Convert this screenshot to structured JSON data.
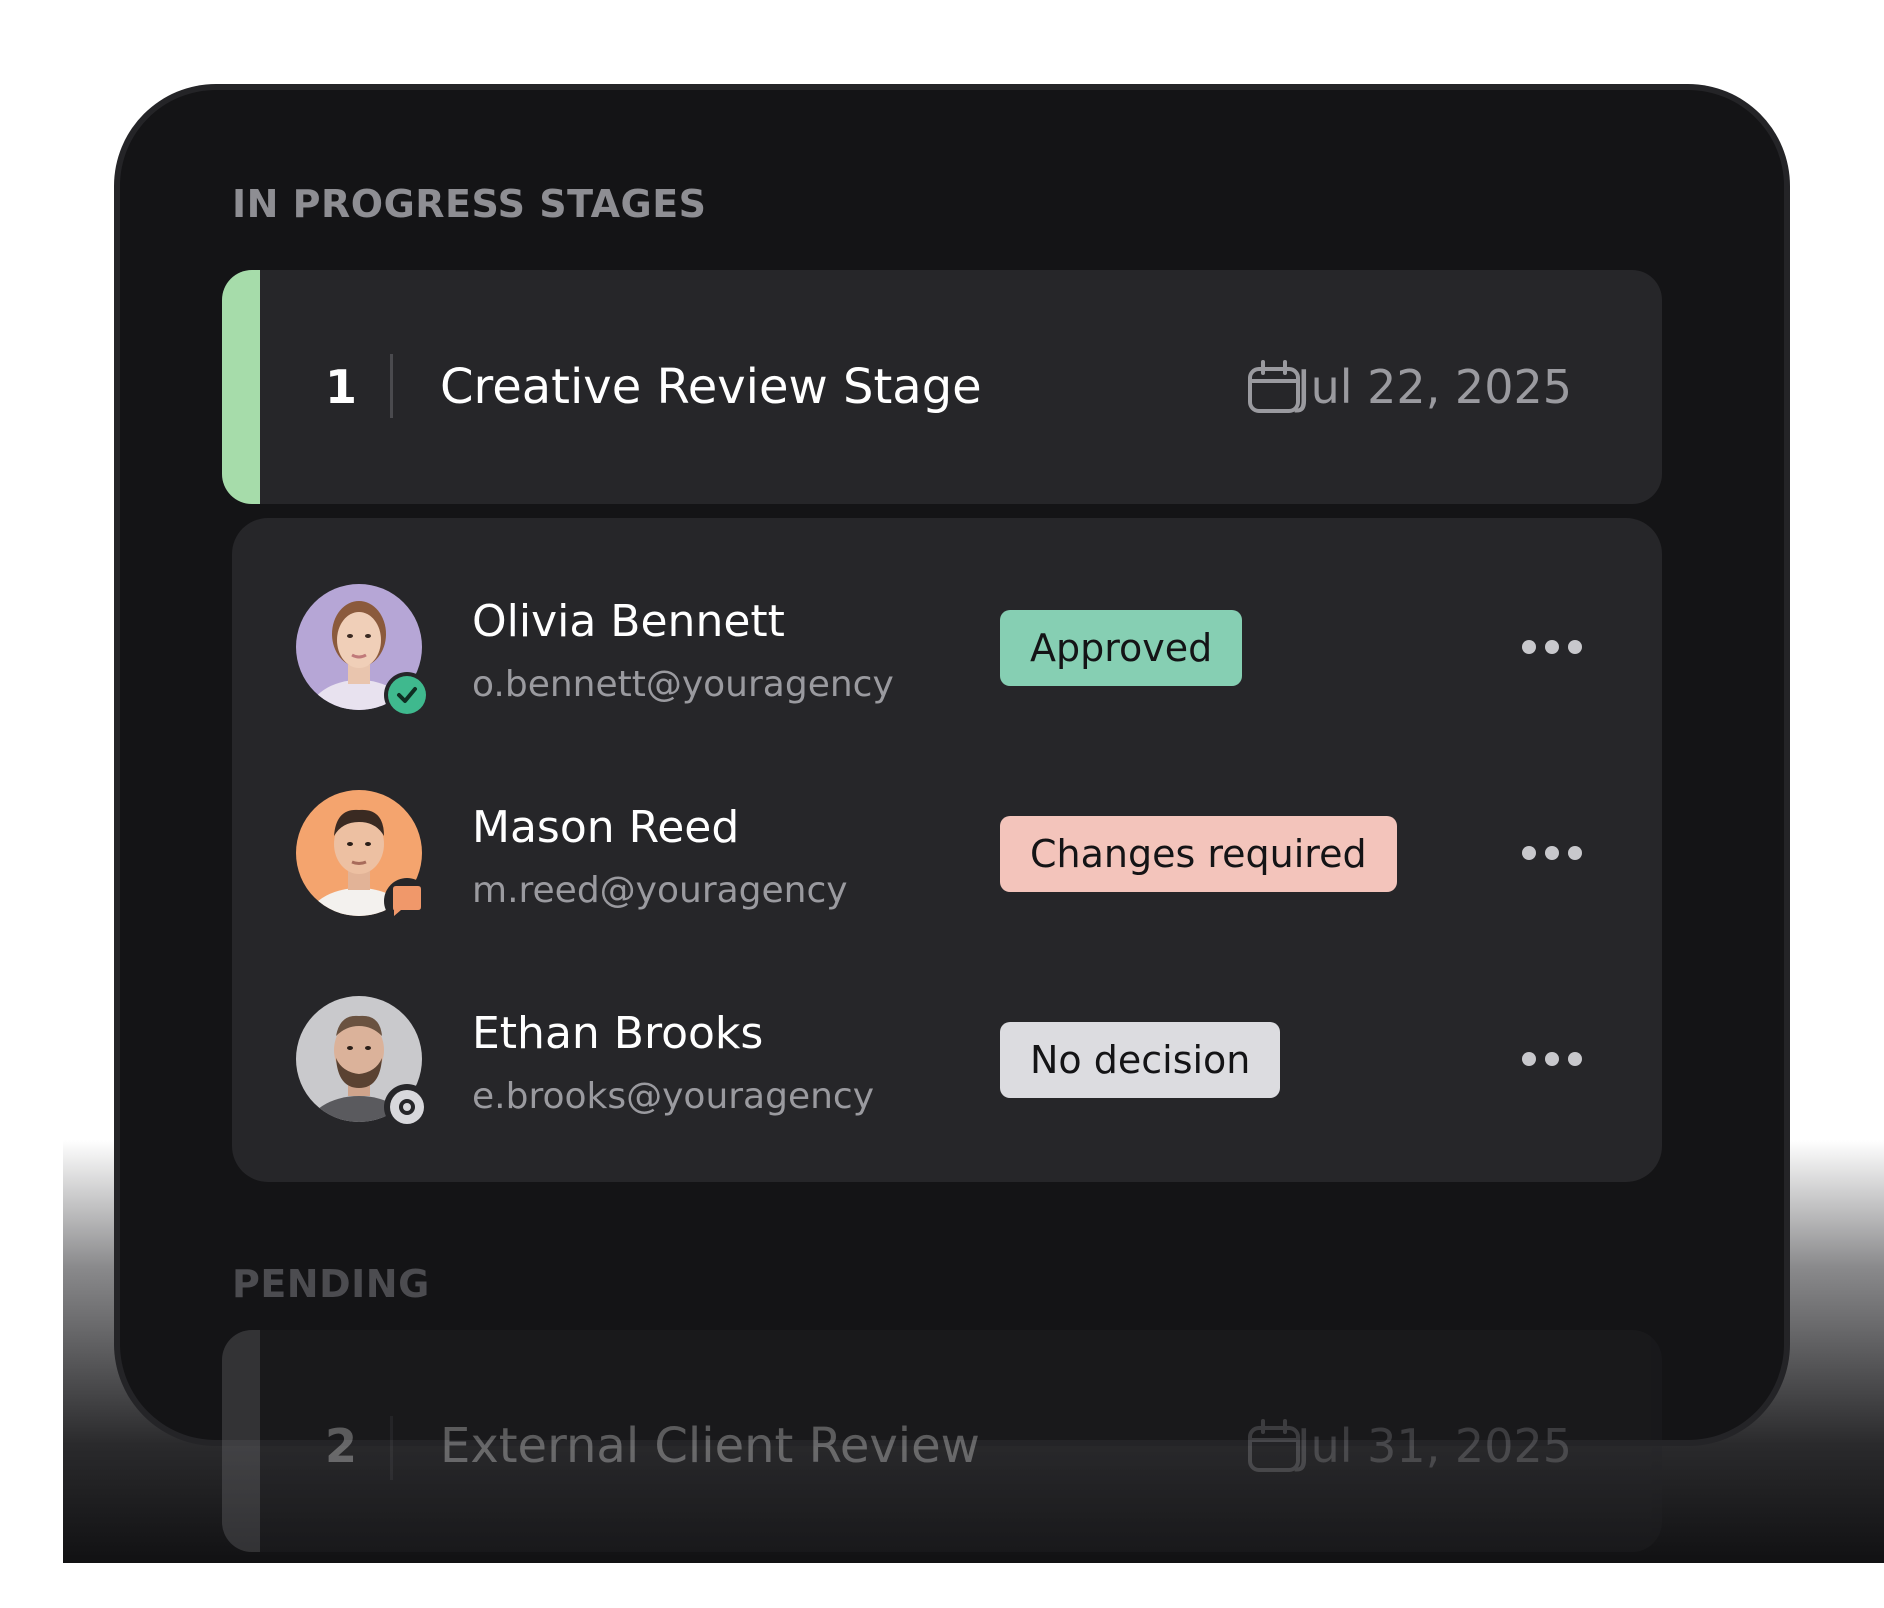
{
  "in_progress": {
    "section_label": "IN PROGRESS STAGES",
    "stage": {
      "number": "1",
      "title": "Creative Review Stage",
      "date": "Jul 22, 2025",
      "accent_color": "#a6dcaa"
    },
    "members": [
      {
        "name": "Olivia Bennett",
        "email": "o.bennett@youragency",
        "status": "Approved",
        "status_color": "#86cfb3",
        "badge_icon": "check-circle-icon",
        "avatar_bg": "#b6a6d6"
      },
      {
        "name": "Mason Reed",
        "email": "m.reed@youragency",
        "status": "Changes required",
        "status_color": "#f3c4bb",
        "badge_icon": "comment-icon",
        "avatar_bg": "#f4a46e"
      },
      {
        "name": "Ethan Brooks",
        "email": "e.brooks@youragency",
        "status": "No decision",
        "status_color": "#dcdce0",
        "badge_icon": "eye-icon",
        "avatar_bg": "#c9c9cc"
      }
    ]
  },
  "pending": {
    "section_label": "PENDING",
    "stage": {
      "number": "2",
      "title": "External Client Review",
      "date": "Jul 31, 2025"
    }
  }
}
